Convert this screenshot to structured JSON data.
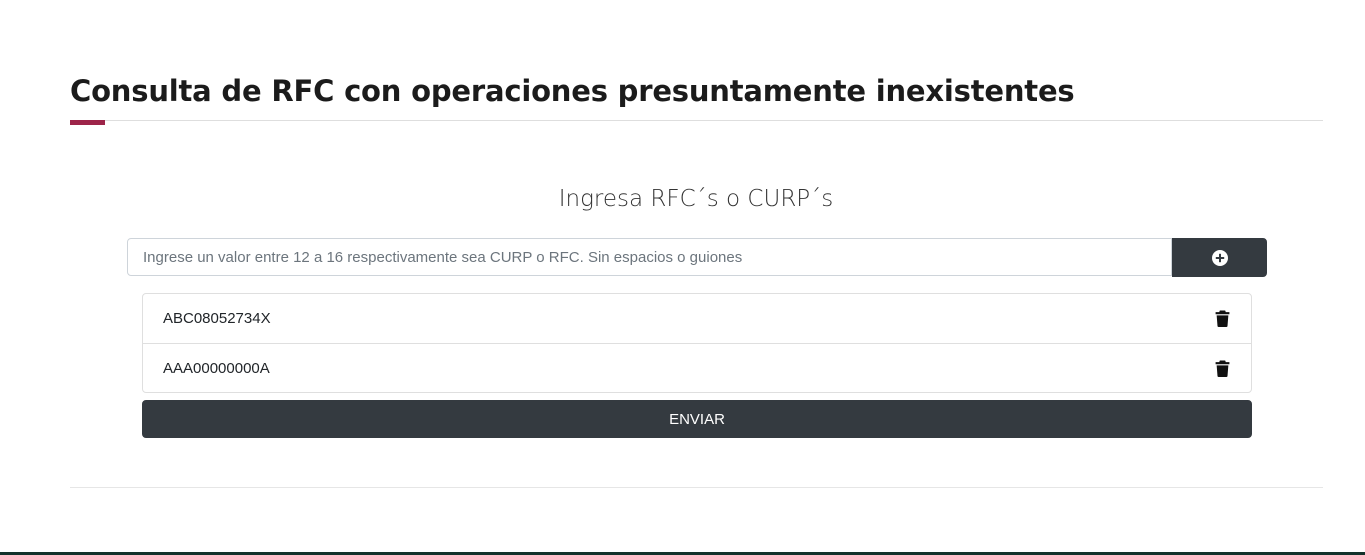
{
  "page": {
    "title": "Consulta de RFC con operaciones presuntamente inexistentes"
  },
  "form": {
    "subtitle": "Ingresa RFC´s o CURP´s",
    "input_placeholder": "Ingrese un valor entre 12 a 16 respectivamente sea CURP o RFC. Sin espacios o guiones",
    "input_value": "",
    "add_button_icon": "plus-circle-icon",
    "items": [
      {
        "value": "ABC08052734X",
        "delete_icon": "trash-icon"
      },
      {
        "value": "AAA00000000A",
        "delete_icon": "trash-icon"
      }
    ],
    "submit_label": "ENVIAR"
  },
  "colors": {
    "accent": "#9d2449",
    "button": "#343a40",
    "footer": "#13322b"
  }
}
